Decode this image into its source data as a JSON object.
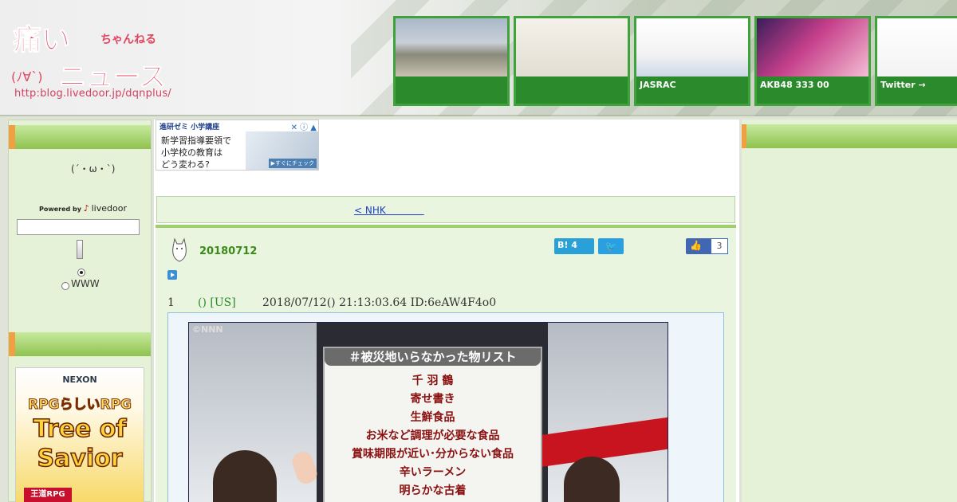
{
  "header": {
    "logo_text_main": "痛いニュース",
    "logo_text_sub": "ちゃんねる",
    "logo_face": "(ﾉ∀`)",
    "logo_url": "http:blog.livedoor.jp/dqnplus/",
    "thumbnails": [
      {
        "caption": ""
      },
      {
        "caption": ""
      },
      {
        "caption": "JASRAC"
      },
      {
        "caption": "AKB48 333 00"
      },
      {
        "caption": "Twitter →"
      }
    ]
  },
  "sidebar": {
    "face": "(´・ω・`)",
    "powered_by": "Powered by",
    "livedoor": "livedoor",
    "search_value": "",
    "radio_www_label": "WWW",
    "game_ad": {
      "brand": "NEXON",
      "line1": "RPGらしいRPG",
      "line2": "Tree of",
      "line3": "Savior",
      "badge": "王道RPG"
    }
  },
  "ad": {
    "head": "進研ゼミ 小学講座",
    "icons": "✕ ⓘ ▲",
    "body_lines": [
      "新学習指導要領で",
      "小学校の教育は",
      "どう変わる?"
    ],
    "cta": "▶すぐにチェック"
  },
  "nav": {
    "link": "< NHK　　　　"
  },
  "article": {
    "date": "20180712",
    "hatena_label": "B!",
    "hatena_count": "4",
    "twitter_icon": "twitter-icon",
    "like_count": "3",
    "post": {
      "num": "1",
      "name": "() [US]",
      "meta": "2018/07/12() 21:13:03.64 ID:6eAW4F4o0"
    },
    "tv": {
      "logo": "©NNN",
      "board_title": "＃被災地いらなかった物リスト",
      "items": [
        "千 羽 鶴",
        "寄せ書き",
        "生鮮食品",
        "お米など調理が必要な食品",
        "賞味期限が近い･分からない食品",
        "辛いラーメン",
        "明らかな古着"
      ]
    }
  },
  "colors": {
    "thumb_border": "#3ea33a",
    "thumb_caption_bg": "#2b8a2b",
    "sidebar_bar": "#8fc24e",
    "sidebar_accent": "#f0a040",
    "article_bg": "#e9f5de",
    "date_green": "#3a8a1a",
    "link_blue": "#1a3fbf"
  }
}
